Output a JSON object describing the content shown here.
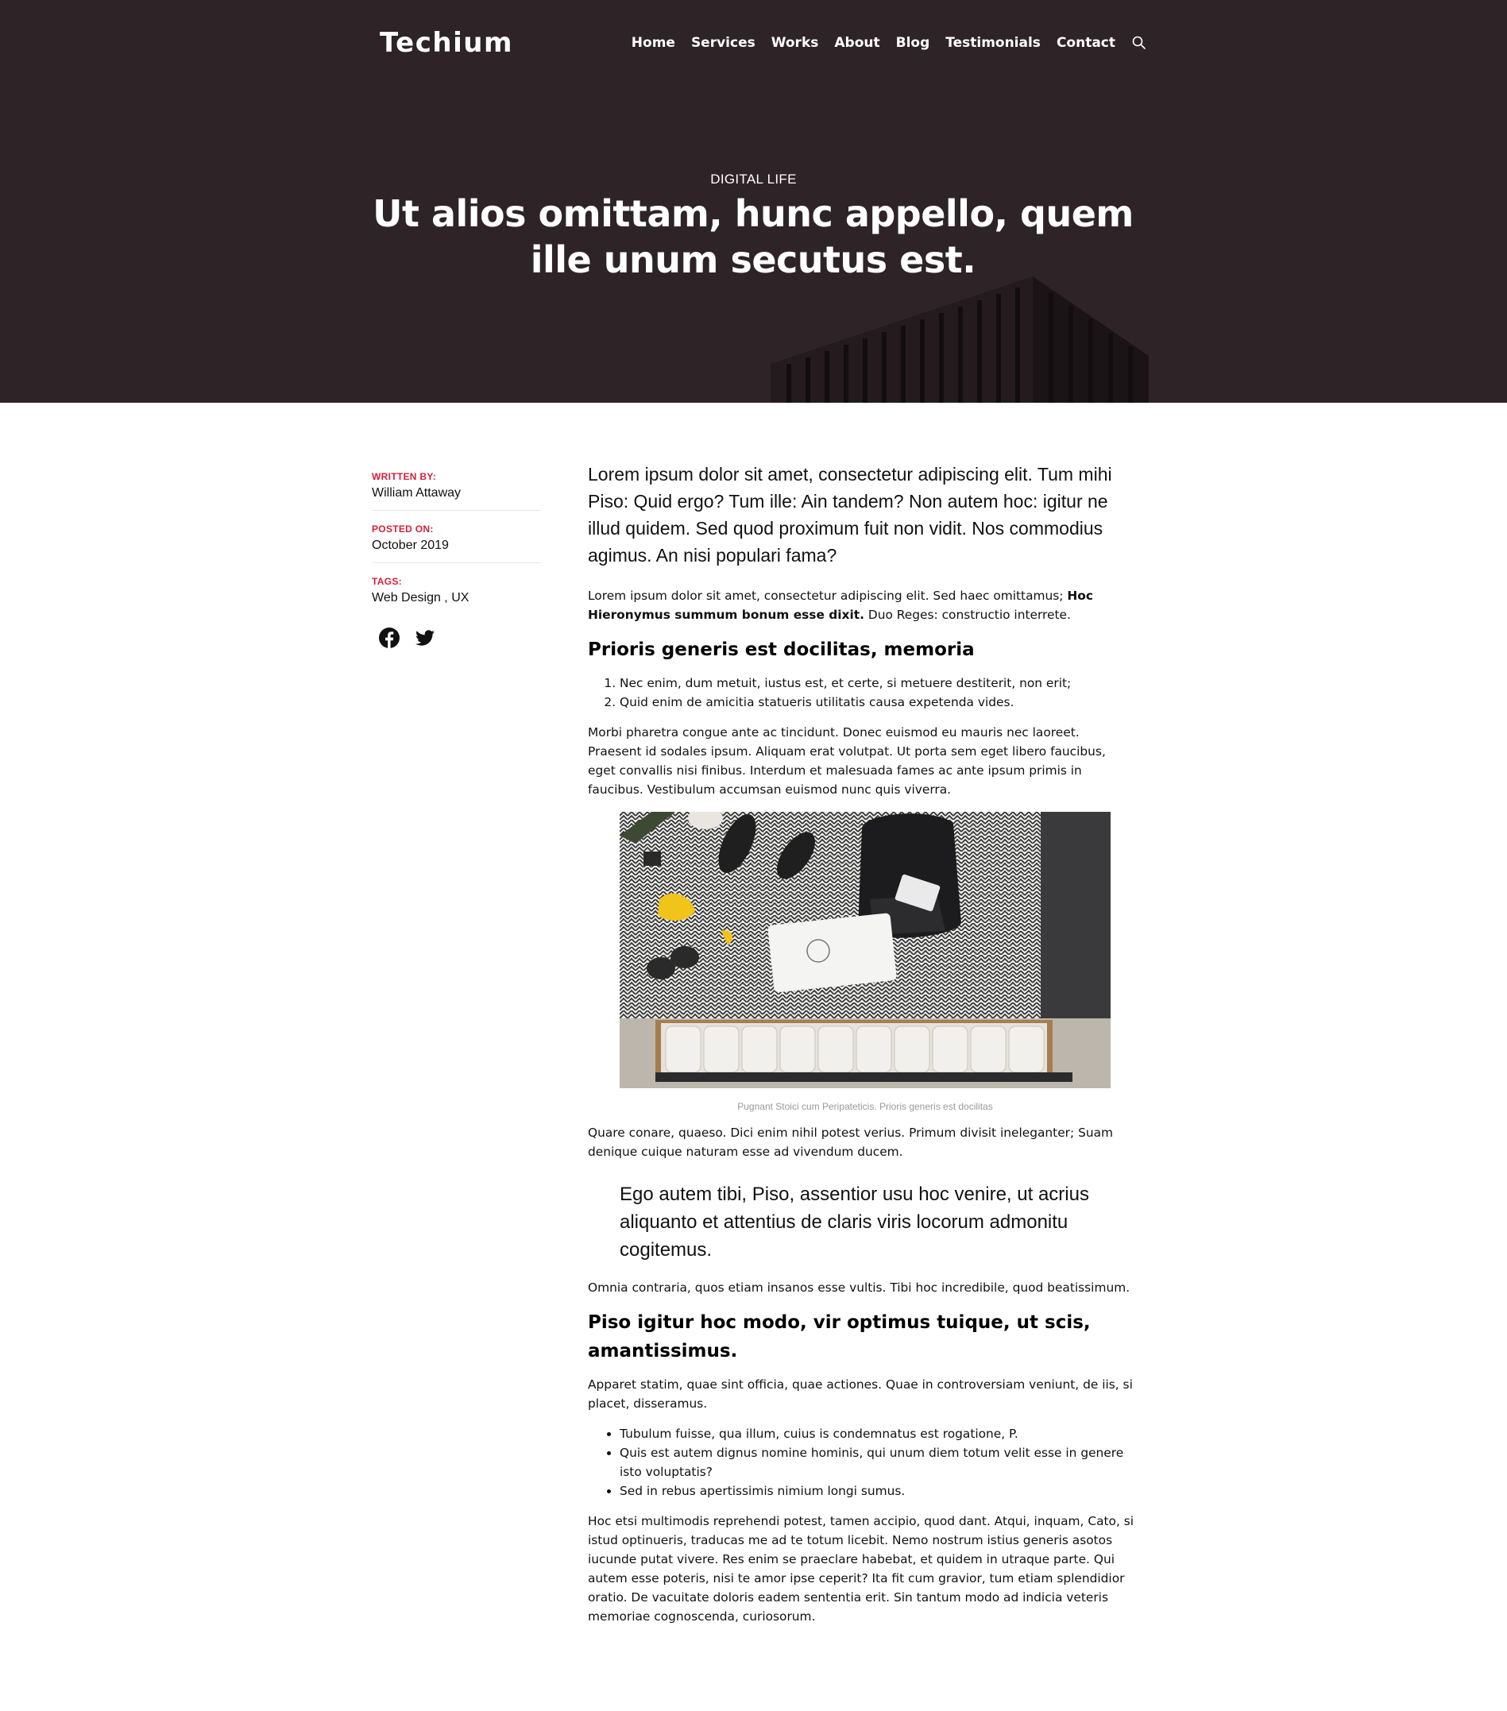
{
  "header": {
    "logo": "Techium",
    "nav": [
      "Home",
      "Services",
      "Works",
      "About",
      "Blog",
      "Testimonials",
      "Contact"
    ]
  },
  "hero": {
    "category": "DIGITAL LIFE",
    "title": "Ut alios omittam, hunc appello, quem ille unum secutus est."
  },
  "meta": {
    "written_by_label": "WRITTEN BY:",
    "written_by": "William Attaway",
    "posted_on_label": "POSTED ON:",
    "posted_on": "October 2019",
    "tags_label": "TAGS:",
    "tags": "Web Design , UX",
    "social_icons": [
      "facebook-icon",
      "twitter-icon"
    ]
  },
  "article": {
    "lead": "Lorem ipsum dolor sit amet, consectetur adipiscing elit. Tum mihi Piso: Quid ergo? Tum ille: Ain tandem? Non autem hoc: igitur ne illud quidem. Sed quod proximum fuit non vidit. Nos commodius agimus. An nisi populari fama?",
    "p1_start": "Lorem ipsum dolor sit amet, consectetur adipiscing elit. Sed haec omittamus; ",
    "p1_bold": "Hoc Hieronymus summum bonum esse dixit.",
    "p1_end": " Duo Reges: constructio interrete.",
    "h2_1": "Prioris generis est docilitas, memoria",
    "ol": [
      "Nec enim, dum metuit, iustus est, et certe, si metuere destiterit, non erit;",
      "Quid enim de amicitia statueris utilitatis causa expetenda vides."
    ],
    "p2": "Morbi pharetra congue ante ac tincidunt. Donec euismod eu mauris nec laoreet. Praesent id sodales ipsum. Aliquam erat volutpat. Ut porta sem eget libero faucibus, eget convallis nisi finibus. Interdum et malesuada fames ac ante ipsum primis in faucibus. Vestibulum accumsan euismod nunc quis viverra.",
    "caption": "Pugnant Stoici cum Peripateticis. Prioris generis est docilitas",
    "p3": "Quare conare, quaeso. Dici enim nihil potest verius. Primum divisit ineleganter; Suam denique cuique naturam esse ad vivendum ducem.",
    "quote": "Ego autem tibi, Piso, assentior usu hoc venire, ut acrius aliquanto et attentius de claris viris locorum admonitu cogitemus.",
    "p4": "Omnia contraria, quos etiam insanos esse vultis. Tibi hoc incredibile, quod beatissimum.",
    "h2_2": "Piso igitur hoc modo, vir optimus tuique, ut scis, amantissimus.",
    "p5": "Apparet statim, quae sint officia, quae actiones. Quae in controversiam veniunt, de iis, si placet, disseramus.",
    "ul": [
      "Tubulum fuisse, qua illum, cuius is condemnatus est rogatione, P.",
      "Quis est autem dignus nomine hominis, qui unum diem totum velit esse in genere isto voluptatis?",
      "Sed in rebus apertissimis nimium longi sumus."
    ],
    "p6": "Hoc etsi multimodis reprehendi potest, tamen accipio, quod dant. Atqui, inquam, Cato, si istud optinueris, traducas me ad te totum licebit. Nemo nostrum istius generis asotos iucunde putat vivere. Res enim se praeclare habebat, et quidem in utraque parte. Qui autem esse poteris, nisi te amor ipse ceperit? Ita fit cum gravior, tum etiam splendidior oratio. De vacuitate doloris eadem sententia erit. Sin tantum modo ad indicia veteris memoriae cognoscenda, curiosorum."
  },
  "colors": {
    "hero_bg": "#2e2428",
    "accent": "#d6203a",
    "text": "#111111"
  }
}
